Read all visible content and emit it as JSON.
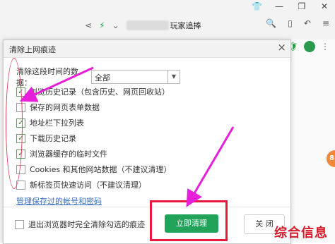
{
  "browser": {
    "address_text": "玩家追捧",
    "window_icons": [
      "shirt-icon",
      "minimize-icon",
      "restore-icon",
      "close-icon"
    ],
    "toolbar_icons": [
      "share-icon",
      "lightning-icon",
      "chevron-down-icon"
    ],
    "right_icons": [
      "search-icon",
      "phone-icon",
      "undo-icon",
      "menu-icon"
    ],
    "side_badge": "8"
  },
  "dialog": {
    "title": "清除上网痕迹",
    "close_glyph": "×",
    "range_label": "清除这段时间的数据：",
    "range_value": "全部",
    "options": [
      {
        "label": "浏览历史记录（包含历史、网页回收站）",
        "checked": true
      },
      {
        "label": "保存的网页表单数据",
        "checked": false
      },
      {
        "label": "地址栏下拉列表",
        "checked": true
      },
      {
        "label": "下载历史记录",
        "checked": true
      },
      {
        "label": "浏览器缓存的临时文件",
        "checked": true
      },
      {
        "label": "Cookies 和其他网站数据（不建议清理）",
        "checked": false
      },
      {
        "label": "新标签页快速访问（不建议清理）",
        "checked": false
      }
    ],
    "manage_link": "管理保存过的帐号和密码",
    "exit_option": "退出浏览器时完全清除勾选的痕迹",
    "clear_button": "立即清理",
    "close_button": "关 闭"
  },
  "annotations": {
    "accent_red": "#e8173b",
    "arrow_color": "#e520d8"
  },
  "watermark": "综合信息"
}
